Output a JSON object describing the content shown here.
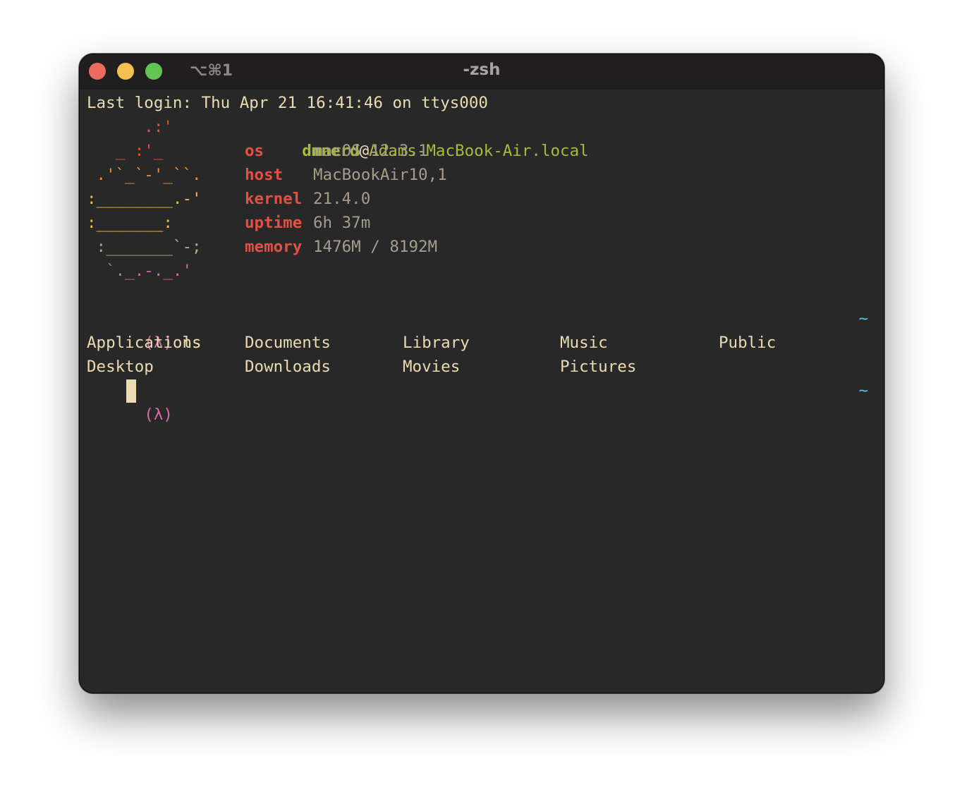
{
  "window": {
    "shortcut": "⌥⌘1",
    "title": "-zsh"
  },
  "terminal": {
    "last_login": "Last login: Thu Apr 21 16:41:46 on ttys000",
    "user": "dmnerd",
    "at": "@",
    "host_name": "Adams-MacBook-Air.local",
    "art": [
      "      .:'",
      "   _ :'_",
      " .'`_`-'_``.",
      ":________.-'",
      ":_______:",
      " :_______`-;",
      "  `._.-._.'"
    ],
    "info": [
      {
        "key": "os",
        "value": "macOS 12.3.1"
      },
      {
        "key": "host",
        "value": "MacBookAir10,1"
      },
      {
        "key": "kernel",
        "value": "21.4.0"
      },
      {
        "key": "uptime",
        "value": "6h 37m"
      },
      {
        "key": "memory",
        "value": "1476M / 8192M"
      }
    ],
    "prompt_symbol": "(λ)",
    "command": "ls",
    "right_prompt": "~",
    "ls_output": [
      [
        "Applications",
        "Documents",
        "Library",
        "Music",
        "Public"
      ],
      [
        "Desktop",
        "Downloads",
        "Movies",
        "Pictures"
      ]
    ]
  },
  "colors": {
    "background": "#282828",
    "titlebar": "#201e1e",
    "foreground": "#ebdbb2",
    "key_red": "#e25143",
    "user_green": "#a8ba3c",
    "prompt_pink": "#d56ca9",
    "tilde_cyan": "#59c2e0",
    "value_gray": "#a59d8c"
  }
}
